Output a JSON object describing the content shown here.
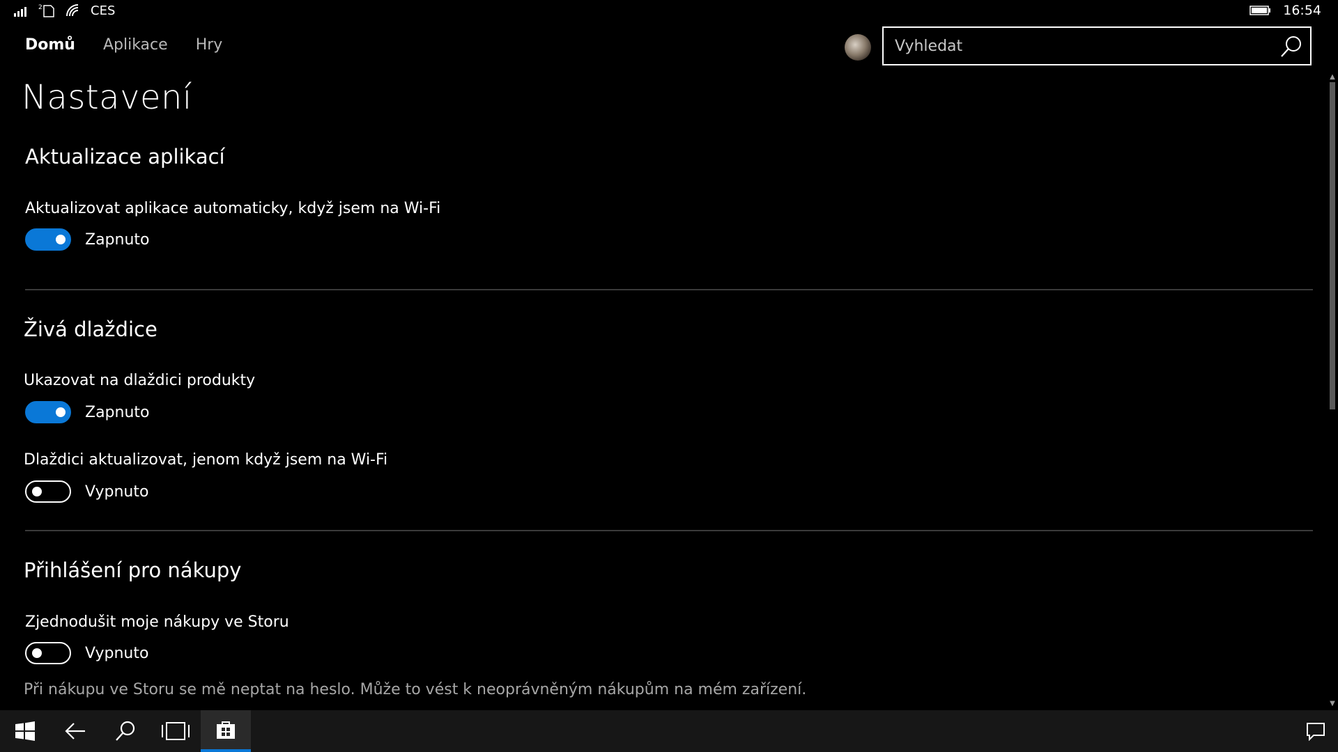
{
  "status_bar": {
    "carrier": "CES",
    "time": "16:54",
    "icons": [
      "signal-icon",
      "sim-icon",
      "wifi-icon",
      "battery-icon"
    ]
  },
  "nav": {
    "items": [
      {
        "label": "Domů",
        "active": true
      },
      {
        "label": "Aplikace",
        "active": false
      },
      {
        "label": "Hry",
        "active": false
      }
    ]
  },
  "search": {
    "placeholder": "Vyhledat",
    "value": ""
  },
  "page": {
    "title": "Nastavení"
  },
  "sections": [
    {
      "title": "Aktualizace aplikací",
      "settings": [
        {
          "label": "Aktualizovat aplikace automaticky, když jsem na Wi-Fi",
          "on": true,
          "state": "Zapnuto"
        }
      ]
    },
    {
      "title": "Živá dlaždice",
      "settings": [
        {
          "label": "Ukazovat na dlaždici produkty",
          "on": true,
          "state": "Zapnuto"
        },
        {
          "label": "Dlaždici aktualizovat, jenom když jsem na Wi-Fi",
          "on": false,
          "state": "Vypnuto"
        }
      ]
    },
    {
      "title": "Přihlášení pro nákupy",
      "settings": [
        {
          "label": "Zjednodušit moje nákupy ve Storu",
          "on": false,
          "state": "Vypnuto"
        }
      ],
      "description": "Při nákupu ve Storu se mě neptat na heslo. Může to vést k neoprávněným nákupům na mém zařízení."
    }
  ],
  "taskbar": {
    "buttons": [
      "windows-start-icon",
      "back-arrow-icon",
      "search-icon",
      "task-view-icon",
      "store-icon"
    ],
    "active": "store-icon",
    "right": "action-center-icon"
  },
  "colors": {
    "accent": "#0a78d7",
    "background": "#000000",
    "taskbar": "#171717",
    "muted_text": "#a6a6a6"
  }
}
